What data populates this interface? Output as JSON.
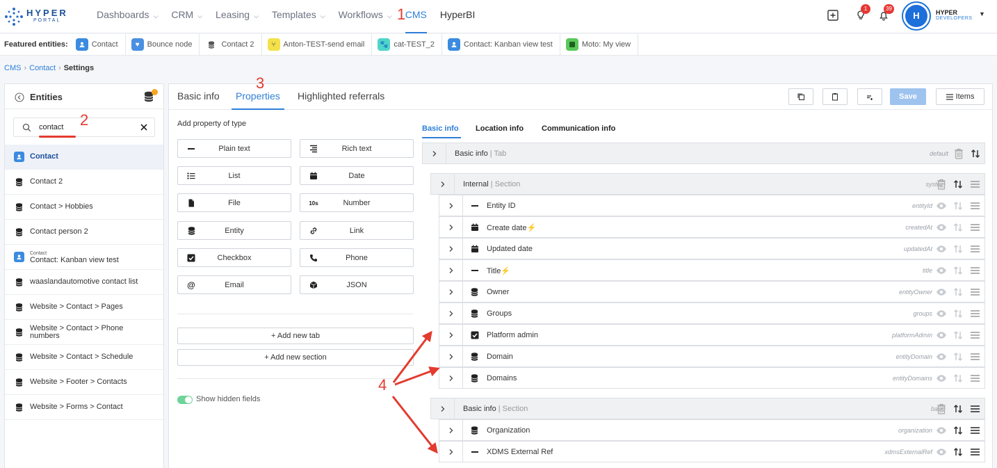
{
  "brand": {
    "name": "HYPER",
    "sub": "PORTAL"
  },
  "nav": [
    {
      "label": "Dashboards",
      "chev": "⌵"
    },
    {
      "label": "CRM",
      "chev": "⌵"
    },
    {
      "label": "Leasing",
      "chev": "⌵"
    },
    {
      "label": "Templates",
      "chev": "⌵"
    },
    {
      "label": "Workflows",
      "chev": "⌵"
    },
    {
      "label": "CMS"
    },
    {
      "label": "HyperBI"
    }
  ],
  "header": {
    "bulb_badge": "1",
    "bell_badge": "39",
    "avatar_initial": "H",
    "user_name": "HYPER",
    "user_org": "DEVELOPERS"
  },
  "featured": {
    "label": "Featured entities:",
    "items": [
      {
        "label": "Contact",
        "color": "#3b8be0"
      },
      {
        "label": "Bounce node",
        "color": "#4a90e2"
      },
      {
        "label": "Contact 2",
        "color": ""
      },
      {
        "label": "Anton-TEST-send email",
        "color": "#f2e14a"
      },
      {
        "label": "cat-TEST_2",
        "color": "#4fd6c9"
      },
      {
        "label": "Contact: Kanban view test",
        "color": "#3b8be0"
      },
      {
        "label": "Moto: My view",
        "color": "#5ac85a"
      }
    ]
  },
  "breadcrumb": {
    "cms": "CMS",
    "sep": "›",
    "contact": "Contact",
    "current": "Settings"
  },
  "entities": {
    "title": "Entities",
    "search_value": "contact",
    "items": [
      {
        "label": "Contact",
        "pre": ""
      },
      {
        "label": "Contact 2",
        "pre": ""
      },
      {
        "label": "Contact > Hobbies",
        "pre": ""
      },
      {
        "label": "Contact person 2",
        "pre": ""
      },
      {
        "label": "Contact: Kanban view test",
        "pre": "Contact"
      },
      {
        "label": "waaslandautomotive contact list",
        "pre": ""
      },
      {
        "label": "Website > Contact > Pages",
        "pre": ""
      },
      {
        "label": "Website > Contact > Phone numbers",
        "pre": ""
      },
      {
        "label": "Website > Contact > Schedule",
        "pre": ""
      },
      {
        "label": "Website > Footer > Contacts",
        "pre": ""
      },
      {
        "label": "Website > Forms > Contact",
        "pre": ""
      }
    ]
  },
  "tabs": {
    "basic": "Basic info",
    "properties": "Properties",
    "referrals": "Highlighted referrals"
  },
  "toolbar": {
    "save": "Save",
    "items": "Items"
  },
  "property_types": {
    "title": "Add property of type",
    "items": [
      {
        "label": "Plain text",
        "icon": "minus-icon"
      },
      {
        "label": "Rich text",
        "icon": "rich-text-icon"
      },
      {
        "label": "List",
        "icon": "list-icon"
      },
      {
        "label": "Date",
        "icon": "calendar-icon"
      },
      {
        "label": "File",
        "icon": "file-icon"
      },
      {
        "label": "Number",
        "icon": "number-icon",
        "glyph": "10s"
      },
      {
        "label": "Entity",
        "icon": "database-icon"
      },
      {
        "label": "Link",
        "icon": "link-icon"
      },
      {
        "label": "Checkbox",
        "icon": "checkbox-icon"
      },
      {
        "label": "Phone",
        "icon": "phone-icon"
      },
      {
        "label": "Email",
        "icon": "at-icon",
        "glyph": "@"
      },
      {
        "label": "JSON",
        "icon": "cube-icon"
      }
    ]
  },
  "actions": {
    "add_tab": "+ Add new tab",
    "add_section": "+ Add new section",
    "show_hidden": "Show hidden fields"
  },
  "subtabs": [
    "Basic info",
    "Location info",
    "Communication info"
  ],
  "tree": {
    "tab": {
      "name": "Basic info",
      "kind": "| Tab",
      "key": "default"
    },
    "sections": [
      {
        "name": "Internal",
        "kind": "| Section",
        "key": "system",
        "fields": [
          {
            "name": "Entity ID",
            "key": "entityId",
            "icon": "minus-icon",
            "bolt": ""
          },
          {
            "name": "Create date",
            "key": "createdAt",
            "icon": "calendar-icon",
            "bolt": "⚡"
          },
          {
            "name": "Updated date",
            "key": "updatedAt",
            "icon": "calendar-icon",
            "bolt": ""
          },
          {
            "name": "Title",
            "key": "title",
            "icon": "minus-icon",
            "bolt": "⚡"
          },
          {
            "name": "Owner",
            "key": "entityOwner",
            "icon": "database-icon",
            "bolt": ""
          },
          {
            "name": "Groups",
            "key": "groups",
            "icon": "database-icon",
            "bolt": ""
          },
          {
            "name": "Platform admin",
            "key": "platformAdmin",
            "icon": "checkbox-icon",
            "bolt": ""
          },
          {
            "name": "Domain",
            "key": "entityDomain",
            "icon": "database-icon",
            "bolt": ""
          },
          {
            "name": "Domains",
            "key": "entityDomains",
            "icon": "database-icon",
            "bolt": ""
          }
        ]
      },
      {
        "name": "Basic info",
        "kind": "| Section",
        "key": "basic",
        "fields": [
          {
            "name": "Organization",
            "key": "organization",
            "icon": "database-icon",
            "bolt": ""
          },
          {
            "name": "XDMS External Ref",
            "key": "xdmsExternalRef",
            "icon": "minus-icon",
            "bolt": ""
          }
        ]
      }
    ]
  },
  "annotations": {
    "a1": "1",
    "a2": "2",
    "a3": "3",
    "a4": "4"
  },
  "colors": {
    "accent": "#2f7fd8",
    "annotation": "#e33b2f",
    "badge": "#e53935",
    "toggle": "#6fd39a"
  }
}
